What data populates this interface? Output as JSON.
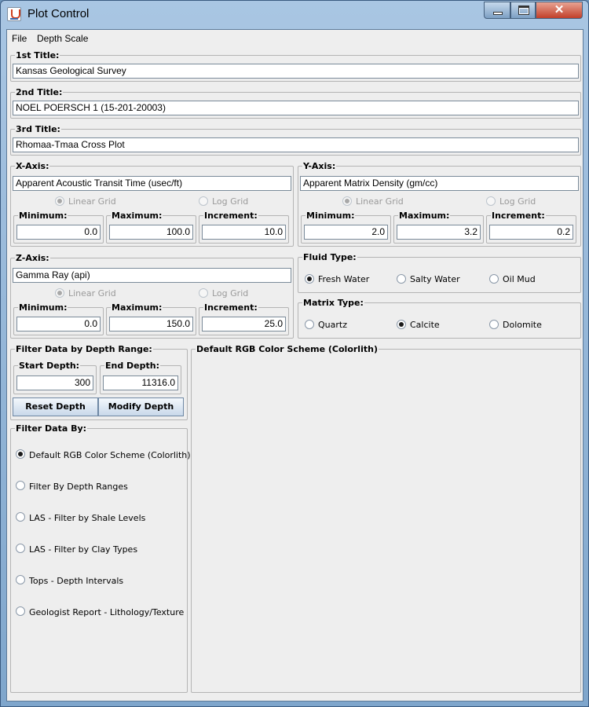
{
  "window": {
    "title": "Plot Control"
  },
  "menu": [
    "File",
    "Depth Scale"
  ],
  "titles": {
    "first": {
      "label": "1st Title:",
      "value": "Kansas Geological Survey"
    },
    "second": {
      "label": "2nd Title:",
      "value": "NOEL POERSCH 1 (15-201-20003)"
    },
    "third": {
      "label": "3rd Title:",
      "value": "Rhomaa-Tmaa Cross Plot"
    }
  },
  "x_axis": {
    "label": "X-Axis:",
    "value": "Apparent Acoustic Transit Time (usec/ft)",
    "linear": "Linear Grid",
    "log": "Log Grid",
    "min_label": "Minimum:",
    "min": "0.0",
    "max_label": "Maximum:",
    "max": "100.0",
    "inc_label": "Increment:",
    "inc": "10.0"
  },
  "y_axis": {
    "label": "Y-Axis:",
    "value": "Apparent Matrix Density (gm/cc)",
    "linear": "Linear Grid",
    "log": "Log Grid",
    "min_label": "Minimum:",
    "min": "2.0",
    "max_label": "Maximum:",
    "max": "3.2",
    "inc_label": "Increment:",
    "inc": "0.2"
  },
  "z_axis": {
    "label": "Z-Axis:",
    "value": "Gamma Ray (api)",
    "linear": "Linear Grid",
    "log": "Log Grid",
    "min_label": "Minimum:",
    "min": "0.0",
    "max_label": "Maximum:",
    "max": "150.0",
    "inc_label": "Increment:",
    "inc": "25.0"
  },
  "fluid": {
    "label": "Fluid Type:",
    "options": [
      "Fresh Water",
      "Salty Water",
      "Oil Mud"
    ]
  },
  "matrix": {
    "label": "Matrix Type:",
    "options": [
      "Quartz",
      "Calcite",
      "Dolomite"
    ]
  },
  "depth": {
    "label": "Filter Data by Depth Range:",
    "start_label": "Start Depth:",
    "start": "300",
    "end_label": "End Depth:",
    "end": "11316.0",
    "reset": "Reset Depth",
    "modify": "Modify Depth"
  },
  "filter": {
    "label": "Filter Data By:",
    "options": [
      "Default RGB Color Scheme (Colorlith)",
      "Filter By Depth Ranges",
      "LAS - Filter by Shale Levels",
      "LAS - Filter by Clay Types",
      "Tops - Depth Intervals",
      "Geologist Report - Lithology/Texture"
    ]
  },
  "scheme": {
    "label": "Default RGB Color Scheme (Colorlith)"
  }
}
